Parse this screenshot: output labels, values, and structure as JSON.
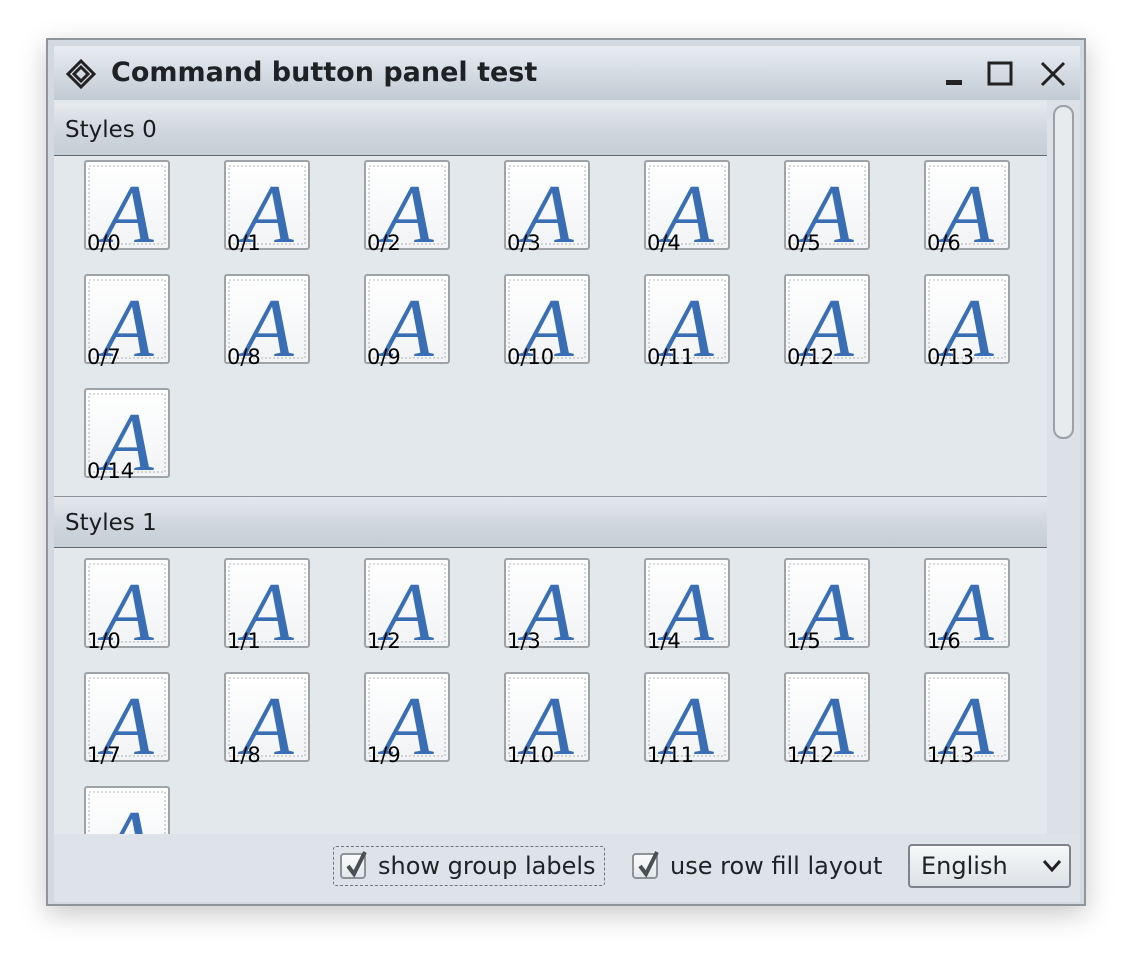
{
  "window": {
    "title": "Command button panel test"
  },
  "groups": [
    {
      "label": "Styles 0",
      "buttons": [
        "0/0",
        "0/1",
        "0/2",
        "0/3",
        "0/4",
        "0/5",
        "0/6",
        "0/7",
        "0/8",
        "0/9",
        "0/10",
        "0/11",
        "0/12",
        "0/13",
        "0/14"
      ]
    },
    {
      "label": "Styles 1",
      "buttons": [
        "1/0",
        "1/1",
        "1/2",
        "1/3",
        "1/4",
        "1/5",
        "1/6",
        "1/7",
        "1/8",
        "1/9",
        "1/10",
        "1/11",
        "1/12",
        "1/13",
        ""
      ]
    }
  ],
  "controls": {
    "show_group_labels": {
      "label": "show group labels",
      "checked": true
    },
    "use_row_fill_layout": {
      "label": "use row fill layout",
      "checked": true
    },
    "language": {
      "selected": "English"
    }
  },
  "icons": {
    "window": "app-diamond-icon",
    "button": "font-letter-a-icon",
    "minimize": "minimize-icon",
    "maximize": "maximize-icon",
    "close": "close-icon",
    "dropdown": "chevron-down-icon"
  },
  "colors": {
    "letter_blue": "#3a6eb4",
    "panel_bg": "#e3e8ec"
  }
}
